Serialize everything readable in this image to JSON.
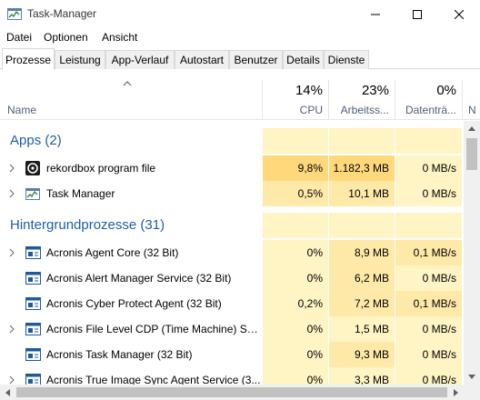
{
  "window": {
    "title": "Task-Manager"
  },
  "menu": {
    "file": "Datei",
    "options": "Optionen",
    "view": "Ansicht"
  },
  "tabs": [
    {
      "label": "Prozesse",
      "active": true
    },
    {
      "label": "Leistung"
    },
    {
      "label": "App-Verlauf"
    },
    {
      "label": "Autostart"
    },
    {
      "label": "Benutzer"
    },
    {
      "label": "Details"
    },
    {
      "label": "Dienste"
    }
  ],
  "columns": {
    "name": "Name",
    "cpu": {
      "pct": "14%",
      "label": "CPU"
    },
    "memory": {
      "pct": "23%",
      "label": "Arbeitss..."
    },
    "disk": {
      "pct": "0%",
      "label": "Datenträ..."
    },
    "network": {
      "label": "N"
    }
  },
  "groups": {
    "apps": "Apps (2)",
    "background": "Hintergrundprozesse (31)"
  },
  "processes": {
    "apps": [
      {
        "name": "rekordbox program file",
        "cpu": "9,8%",
        "mem": "1.182,3 MB",
        "disk": "0 MB/s",
        "expandable": true,
        "icon": "rekordbox-icon"
      },
      {
        "name": "Task Manager",
        "cpu": "0,5%",
        "mem": "10,1 MB",
        "disk": "0 MB/s",
        "expandable": true,
        "icon": "task-manager-icon"
      }
    ],
    "background": [
      {
        "name": "Acronis Agent Core (32 Bit)",
        "cpu": "0%",
        "mem": "8,9 MB",
        "disk": "0,1 MB/s",
        "expandable": true,
        "icon": "service-window-icon"
      },
      {
        "name": "Acronis Alert Manager Service (32 Bit)",
        "cpu": "0%",
        "mem": "6,2 MB",
        "disk": "0 MB/s",
        "expandable": false,
        "icon": "service-window-icon"
      },
      {
        "name": "Acronis Cyber Protect Agent (32 Bit)",
        "cpu": "0,2%",
        "mem": "7,2 MB",
        "disk": "0,1 MB/s",
        "expandable": false,
        "icon": "service-window-icon"
      },
      {
        "name": "Acronis File Level CDP (Time Machine) Se...",
        "cpu": "0%",
        "mem": "1,5 MB",
        "disk": "0 MB/s",
        "expandable": true,
        "icon": "service-window-icon"
      },
      {
        "name": "Acronis Task Manager (32 Bit)",
        "cpu": "0%",
        "mem": "9,3 MB",
        "disk": "0 MB/s",
        "expandable": false,
        "icon": "service-window-icon"
      },
      {
        "name": "Acronis True Image Sync Agent Service (3...",
        "cpu": "0%",
        "mem": "3,3 MB",
        "disk": "0 MB/s",
        "expandable": true,
        "icon": "service-window-icon"
      }
    ]
  },
  "colors": {
    "heat_light": "#fff4c4",
    "heat_mid": "#ffe9a8",
    "heat_strong": "#ffd87c",
    "group_title": "#1f5ea8",
    "header_label": "#4c607a"
  }
}
